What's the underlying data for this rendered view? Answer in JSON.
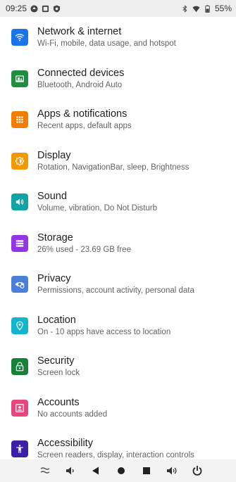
{
  "status_bar": {
    "time": "09:25",
    "battery": "55%",
    "left_icons": [
      "assistant-icon",
      "notification-icon",
      "shield-icon"
    ],
    "right_icons": [
      "bluetooth-icon",
      "wifi-icon",
      "battery-icon"
    ]
  },
  "settings": [
    {
      "title": "Network & internet",
      "subtitle": "Wi-Fi, mobile, data usage, and hotspot",
      "icon": "wifi-icon",
      "color": "#1a73e8"
    },
    {
      "title": "Connected devices",
      "subtitle": "Bluetooth, Android Auto",
      "icon": "devices-icon",
      "color": "#1e8e3e"
    },
    {
      "title": "Apps & notifications",
      "subtitle": "Recent apps, default apps",
      "icon": "apps-icon",
      "color": "#f57c00"
    },
    {
      "title": "Display",
      "subtitle": "Rotation, NavigationBar, sleep, Brightness",
      "icon": "brightness-icon",
      "color": "#f29900"
    },
    {
      "title": "Sound",
      "subtitle": "Volume, vibration, Do Not Disturb",
      "icon": "volume-icon",
      "color": "#12a4a4"
    },
    {
      "title": "Storage",
      "subtitle": "26% used - 23.69 GB free",
      "icon": "storage-icon",
      "color": "#9334e6"
    },
    {
      "title": "Privacy",
      "subtitle": "Permissions, account activity, personal data",
      "icon": "privacy-icon",
      "color": "#4a7fd8"
    },
    {
      "title": "Location",
      "subtitle": "On - 10 apps have access to location",
      "icon": "location-icon",
      "color": "#12b5cb"
    },
    {
      "title": "Security",
      "subtitle": "Screen lock",
      "icon": "lock-icon",
      "color": "#188038"
    },
    {
      "title": "Accounts",
      "subtitle": "No accounts added",
      "icon": "account-icon",
      "color": "#e8457c"
    },
    {
      "title": "Accessibility",
      "subtitle": "Screen readers, display, interaction controls",
      "icon": "accessibility-icon",
      "color": "#3c1fa8"
    }
  ],
  "nav_bar": [
    "collapse-icon",
    "volume-down-icon",
    "back-icon",
    "home-icon",
    "recents-icon",
    "volume-up-icon",
    "power-icon"
  ]
}
